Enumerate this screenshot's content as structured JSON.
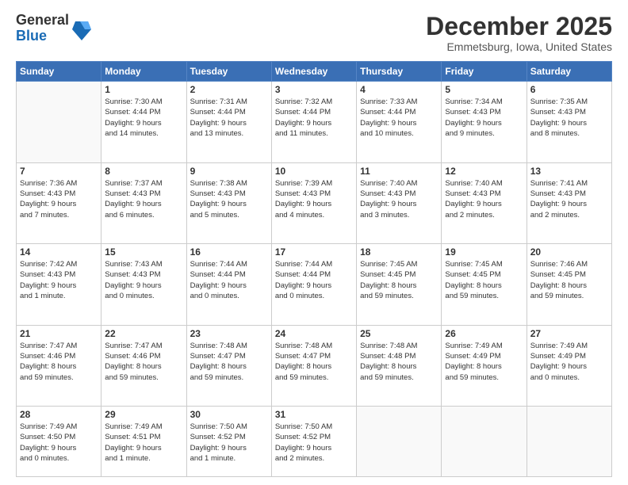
{
  "logo": {
    "general": "General",
    "blue": "Blue"
  },
  "header": {
    "month": "December 2025",
    "location": "Emmetsburg, Iowa, United States"
  },
  "days": [
    "Sunday",
    "Monday",
    "Tuesday",
    "Wednesday",
    "Thursday",
    "Friday",
    "Saturday"
  ],
  "weeks": [
    [
      {
        "day": "",
        "content": ""
      },
      {
        "day": "1",
        "content": "Sunrise: 7:30 AM\nSunset: 4:44 PM\nDaylight: 9 hours\nand 14 minutes."
      },
      {
        "day": "2",
        "content": "Sunrise: 7:31 AM\nSunset: 4:44 PM\nDaylight: 9 hours\nand 13 minutes."
      },
      {
        "day": "3",
        "content": "Sunrise: 7:32 AM\nSunset: 4:44 PM\nDaylight: 9 hours\nand 11 minutes."
      },
      {
        "day": "4",
        "content": "Sunrise: 7:33 AM\nSunset: 4:44 PM\nDaylight: 9 hours\nand 10 minutes."
      },
      {
        "day": "5",
        "content": "Sunrise: 7:34 AM\nSunset: 4:43 PM\nDaylight: 9 hours\nand 9 minutes."
      },
      {
        "day": "6",
        "content": "Sunrise: 7:35 AM\nSunset: 4:43 PM\nDaylight: 9 hours\nand 8 minutes."
      }
    ],
    [
      {
        "day": "7",
        "content": "Sunrise: 7:36 AM\nSunset: 4:43 PM\nDaylight: 9 hours\nand 7 minutes."
      },
      {
        "day": "8",
        "content": "Sunrise: 7:37 AM\nSunset: 4:43 PM\nDaylight: 9 hours\nand 6 minutes."
      },
      {
        "day": "9",
        "content": "Sunrise: 7:38 AM\nSunset: 4:43 PM\nDaylight: 9 hours\nand 5 minutes."
      },
      {
        "day": "10",
        "content": "Sunrise: 7:39 AM\nSunset: 4:43 PM\nDaylight: 9 hours\nand 4 minutes."
      },
      {
        "day": "11",
        "content": "Sunrise: 7:40 AM\nSunset: 4:43 PM\nDaylight: 9 hours\nand 3 minutes."
      },
      {
        "day": "12",
        "content": "Sunrise: 7:40 AM\nSunset: 4:43 PM\nDaylight: 9 hours\nand 2 minutes."
      },
      {
        "day": "13",
        "content": "Sunrise: 7:41 AM\nSunset: 4:43 PM\nDaylight: 9 hours\nand 2 minutes."
      }
    ],
    [
      {
        "day": "14",
        "content": "Sunrise: 7:42 AM\nSunset: 4:43 PM\nDaylight: 9 hours\nand 1 minute."
      },
      {
        "day": "15",
        "content": "Sunrise: 7:43 AM\nSunset: 4:43 PM\nDaylight: 9 hours\nand 0 minutes."
      },
      {
        "day": "16",
        "content": "Sunrise: 7:44 AM\nSunset: 4:44 PM\nDaylight: 9 hours\nand 0 minutes."
      },
      {
        "day": "17",
        "content": "Sunrise: 7:44 AM\nSunset: 4:44 PM\nDaylight: 9 hours\nand 0 minutes."
      },
      {
        "day": "18",
        "content": "Sunrise: 7:45 AM\nSunset: 4:45 PM\nDaylight: 8 hours\nand 59 minutes."
      },
      {
        "day": "19",
        "content": "Sunrise: 7:45 AM\nSunset: 4:45 PM\nDaylight: 8 hours\nand 59 minutes."
      },
      {
        "day": "20",
        "content": "Sunrise: 7:46 AM\nSunset: 4:45 PM\nDaylight: 8 hours\nand 59 minutes."
      }
    ],
    [
      {
        "day": "21",
        "content": "Sunrise: 7:47 AM\nSunset: 4:46 PM\nDaylight: 8 hours\nand 59 minutes."
      },
      {
        "day": "22",
        "content": "Sunrise: 7:47 AM\nSunset: 4:46 PM\nDaylight: 8 hours\nand 59 minutes."
      },
      {
        "day": "23",
        "content": "Sunrise: 7:48 AM\nSunset: 4:47 PM\nDaylight: 8 hours\nand 59 minutes."
      },
      {
        "day": "24",
        "content": "Sunrise: 7:48 AM\nSunset: 4:47 PM\nDaylight: 8 hours\nand 59 minutes."
      },
      {
        "day": "25",
        "content": "Sunrise: 7:48 AM\nSunset: 4:48 PM\nDaylight: 8 hours\nand 59 minutes."
      },
      {
        "day": "26",
        "content": "Sunrise: 7:49 AM\nSunset: 4:49 PM\nDaylight: 8 hours\nand 59 minutes."
      },
      {
        "day": "27",
        "content": "Sunrise: 7:49 AM\nSunset: 4:49 PM\nDaylight: 9 hours\nand 0 minutes."
      }
    ],
    [
      {
        "day": "28",
        "content": "Sunrise: 7:49 AM\nSunset: 4:50 PM\nDaylight: 9 hours\nand 0 minutes."
      },
      {
        "day": "29",
        "content": "Sunrise: 7:49 AM\nSunset: 4:51 PM\nDaylight: 9 hours\nand 1 minute."
      },
      {
        "day": "30",
        "content": "Sunrise: 7:50 AM\nSunset: 4:52 PM\nDaylight: 9 hours\nand 1 minute."
      },
      {
        "day": "31",
        "content": "Sunrise: 7:50 AM\nSunset: 4:52 PM\nDaylight: 9 hours\nand 2 minutes."
      },
      {
        "day": "",
        "content": ""
      },
      {
        "day": "",
        "content": ""
      },
      {
        "day": "",
        "content": ""
      }
    ]
  ]
}
